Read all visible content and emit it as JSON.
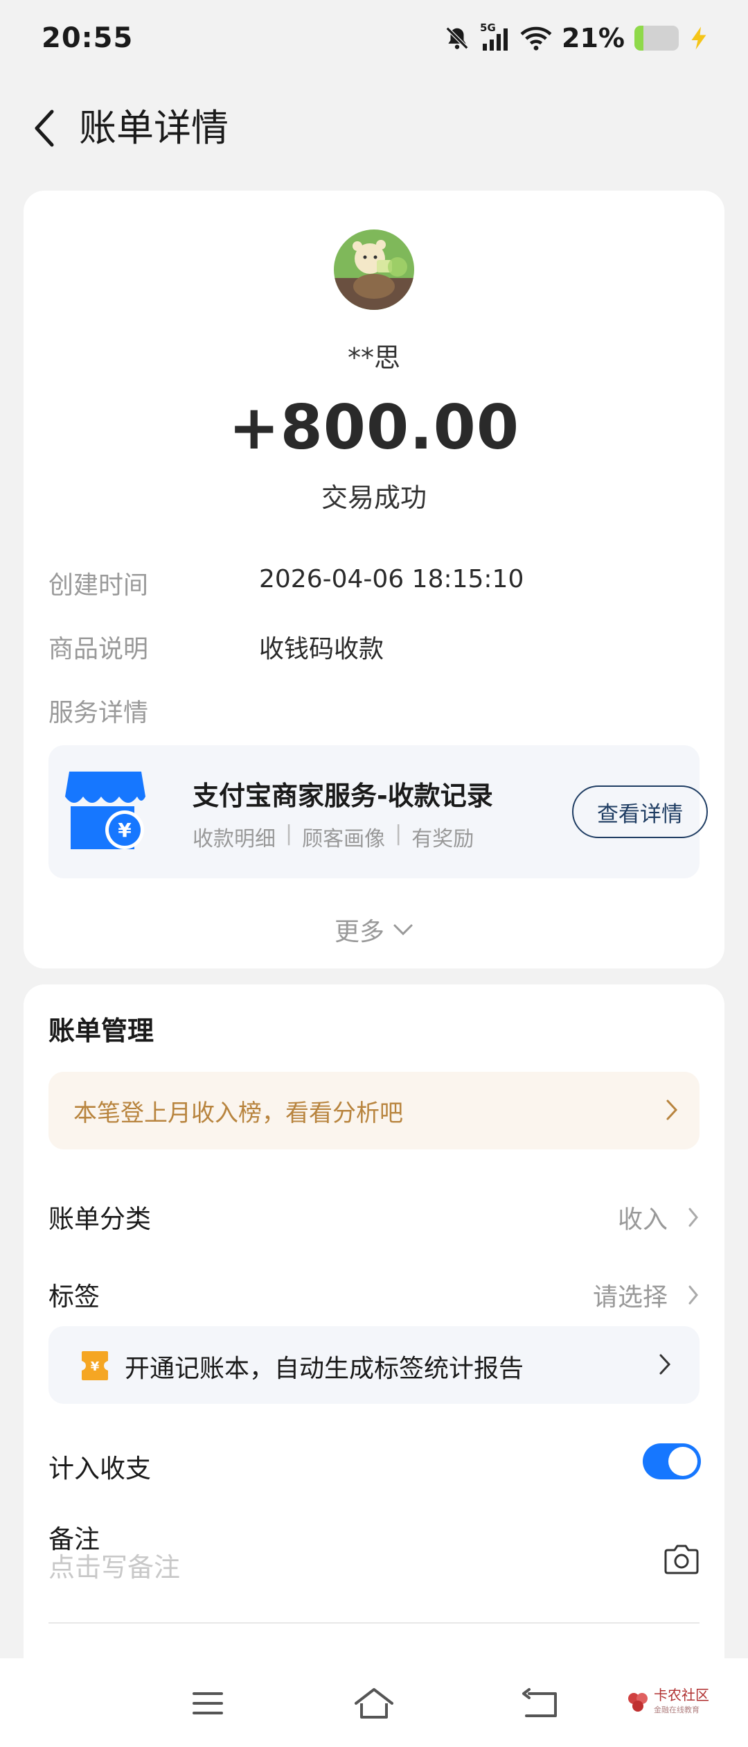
{
  "status_bar": {
    "time": "20:55",
    "network": "5G",
    "battery": "21%",
    "battery_level": 0.21,
    "icons": [
      "mute-bell-icon",
      "signal-5g-icon",
      "wifi-icon",
      "battery-icon",
      "charging-icon"
    ]
  },
  "header": {
    "title": "账单详情",
    "back_icon": "chevron-left-icon"
  },
  "transaction": {
    "payer": "**思",
    "amount": "+800.00",
    "status": "交易成功"
  },
  "details": [
    {
      "label": "创建时间",
      "value": "2026-04-06 18:15:10"
    },
    {
      "label": "商品说明",
      "value": "收钱码收款"
    },
    {
      "label": "服务详情",
      "value": ""
    }
  ],
  "merchant_service": {
    "title": "支付宝商家服务-收款记录",
    "tags": [
      "收款明细",
      "顾客画像",
      "有奖励"
    ],
    "separator": "|",
    "button": "查看详情",
    "icon": "shop-yuan-icon"
  },
  "more": {
    "label": "更多",
    "icon": "chevron-down-icon"
  },
  "manage": {
    "title": "账单管理",
    "ranking_banner": "本笔登上月收入榜，看看分析吧",
    "category": {
      "label": "账单分类",
      "value": "收入"
    },
    "tag": {
      "label": "标签",
      "value": "请选择"
    },
    "ledger_banner": "开通记账本，自动生成标签统计报告",
    "include": {
      "label": "计入收支",
      "enabled": true
    },
    "note": {
      "label": "备注",
      "placeholder": "点击写备注"
    }
  },
  "colors": {
    "accent": "#1677ff",
    "gold": "#b8843e",
    "background": "#f2f2f2"
  },
  "nav": {
    "icons": [
      "menu-icon",
      "home-icon",
      "back-icon"
    ],
    "watermark_logo": "卡农社区",
    "watermark_sub": "金融在线教育"
  }
}
